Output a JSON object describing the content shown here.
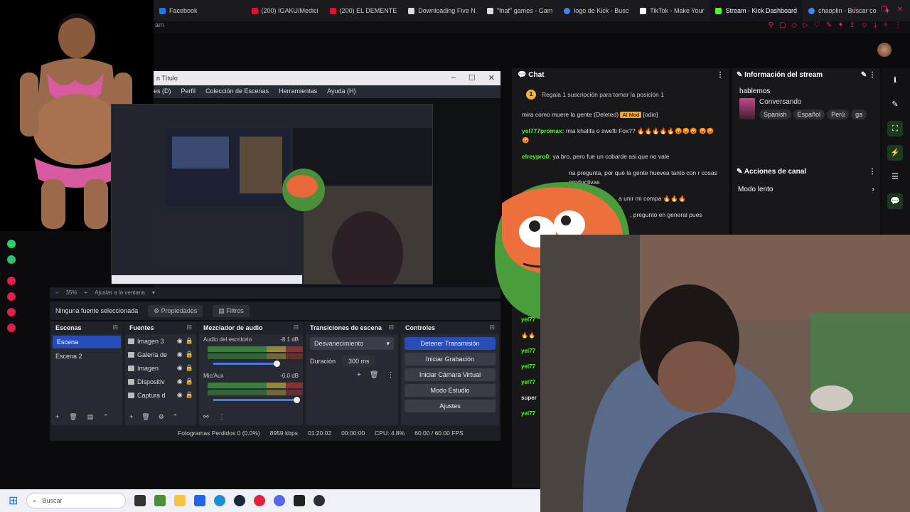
{
  "browser": {
    "tabs": [
      {
        "label": "Facebook",
        "color": "#1877f2"
      },
      {
        "label": "(200) IGAKU/Medici",
        "color": "#ff0033"
      },
      {
        "label": "(200) EL DEMENTE",
        "color": "#ff0033"
      },
      {
        "label": "Downloading Five N",
        "color": "#dddddd"
      },
      {
        "label": "\"fnaf\" games - Gam",
        "color": "#dddddd"
      },
      {
        "label": "logo de Kick - Busc",
        "color": "#4285f4"
      },
      {
        "label": "TikTok - Make Your",
        "color": "#ffffff"
      },
      {
        "label": "Stream - Kick Dashboard",
        "color": "#53fc18",
        "active": true
      },
      {
        "label": "chaoplin - Buscar co",
        "color": "#4285f4"
      }
    ],
    "address_fragment": "am"
  },
  "obs": {
    "title": "n Título",
    "menu": [
      "es (D)",
      "Perfil",
      "Colección de Escenas",
      "Herramientas",
      "Ayuda (H)"
    ],
    "zoom": "35%",
    "fit": "Ajustar a la ventana",
    "no_source": "Ninguna fuente seleccionada",
    "properties": "Propiedades",
    "filters": "Filtros",
    "scenes_title": "Escenas",
    "scenes": [
      "Escena",
      "Escena 2"
    ],
    "sources_title": "Fuentes",
    "sources": [
      "Imagen 3",
      "Galería de",
      "Imagen",
      "Dispositiv",
      "Captura d"
    ],
    "mixer_title": "Mezclador de audio",
    "mixer": [
      {
        "name": "Audio del escritorio",
        "db": "-8.1 dB"
      },
      {
        "name": "Mic/Aux",
        "db": "-0.0 dB"
      }
    ],
    "transitions_title": "Transiciones de escena",
    "transition": "Desvanecimiento",
    "duration_label": "Duración",
    "duration": "300 ms",
    "controls_title": "Controles",
    "controls": [
      "Detener Transmisión",
      "Iniciar Grabación",
      "Iniciar Cámara Virtual",
      "Modo Estudio",
      "Ajustes"
    ],
    "status": {
      "dropped": "Fotogramas Perdidos 0 (0.0%)",
      "bitrate": "8959 kbps",
      "live": "01:20:02",
      "rec": "00:00:00",
      "cpu": "CPU: 4.8%",
      "fps": "60.00 / 60.00 FPS"
    }
  },
  "chat": {
    "title": "Chat",
    "gift_rank": "1",
    "gift_text": "Regala 1 suscripción para tomar la posición 1",
    "messages": [
      {
        "user": "",
        "text": "mira como muere la gente",
        "extra": "(Deleted)",
        "badge": "AI Mod",
        "tail": "[odio]"
      },
      {
        "user": "yel777promax:",
        "text": "mia khalifa o swefti Fox?? 🔥🔥🔥🔥🔥😡😡😡 😡😡😡"
      },
      {
        "user": "elreypro0:",
        "text": "ya bro, pero fue un cobarde asi que no vale"
      },
      {
        "user": "",
        "text": "na pregunta, por qué la gente huevea tanto con r cosas productivas"
      },
      {
        "user": "",
        "text": "a unir mi compa 🔥🔥🔥"
      },
      {
        "user": "",
        "text": ", pregunto en general pues"
      }
    ],
    "side_users": [
      "yel77",
      "🔥🔥",
      "yel77",
      "yel77",
      "yel77",
      "super",
      "yel77"
    ]
  },
  "stream_info": {
    "title": "Información del stream",
    "stream_title": "hablemos",
    "category": "Conversando",
    "tags": [
      "Spanish",
      "Español",
      "Perú",
      "ga"
    ],
    "actions_title": "Acciones de canal",
    "slow_mode": "Modo lento"
  },
  "taskbar": {
    "search": "Buscar"
  }
}
